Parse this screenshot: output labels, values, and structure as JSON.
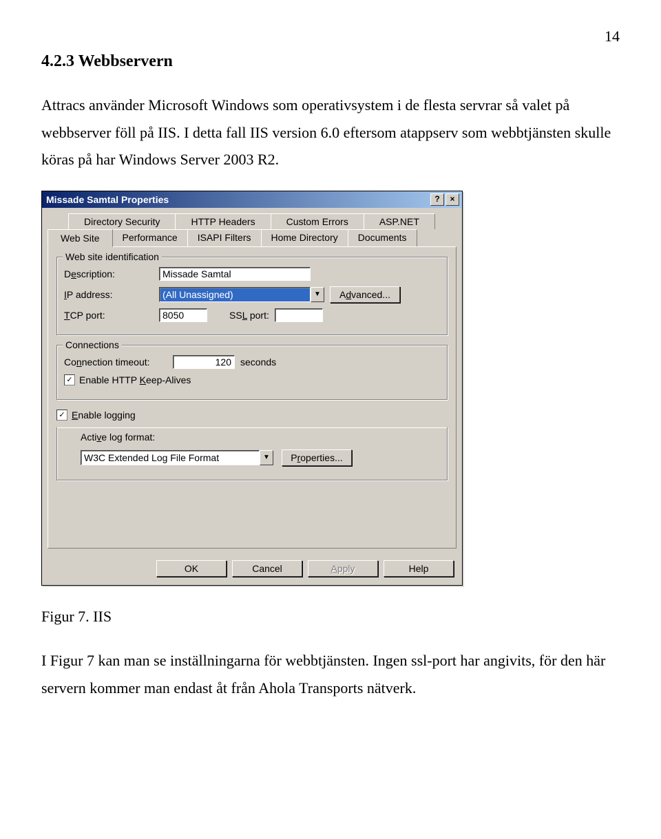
{
  "page_number": "14",
  "heading": "4.2.3 Webbservern",
  "para1": "Attracs använder Microsoft Windows som operativsystem i de flesta servrar så valet på webbserver föll på IIS. I detta fall IIS version 6.0 eftersom atappserv som webbtjänsten skulle köras på har Windows Server 2003 R2.",
  "figure_caption": "Figur 7. IIS",
  "para2": "I Figur 7 kan man se inställningarna för webbtjänsten. Ingen ssl-port har angivits, för den här servern kommer man endast åt från Ahola Transports nätverk.",
  "dialog": {
    "title": "Missade Samtal Properties",
    "tabs_back": [
      "Directory Security",
      "HTTP Headers",
      "Custom Errors",
      "ASP.NET"
    ],
    "tabs_front": [
      "Web Site",
      "Performance",
      "ISAPI Filters",
      "Home Directory",
      "Documents"
    ],
    "active_tab": "Web Site",
    "group_identification": {
      "title": "Web site identification",
      "description_label": "Description:",
      "description_value": "Missade Samtal",
      "ip_label": "IP address:",
      "ip_value": "(All Unassigned)",
      "advanced_button": "Advanced...",
      "tcp_label": "TCP port:",
      "tcp_value": "8050",
      "ssl_label": "SSL port:",
      "ssl_value": ""
    },
    "group_connections": {
      "title": "Connections",
      "timeout_label": "Connection timeout:",
      "timeout_value": "120",
      "timeout_unit": "seconds",
      "keepalive_label": "Enable HTTP Keep-Alives"
    },
    "logging": {
      "enable_label": "Enable logging",
      "format_label": "Active log format:",
      "format_value": "W3C Extended Log File Format",
      "properties_button": "Properties..."
    },
    "buttons": {
      "ok": "OK",
      "cancel": "Cancel",
      "apply": "Apply",
      "help": "Help"
    }
  }
}
